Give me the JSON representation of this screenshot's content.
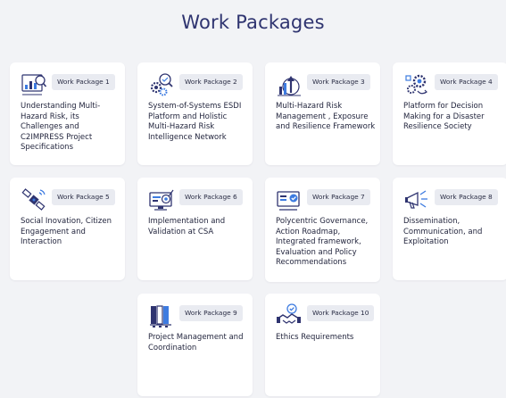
{
  "page": {
    "title": "Work Packages"
  },
  "colors": {
    "background": "#f2f3f6",
    "card": "#ffffff",
    "accent": "#2f3470",
    "badge": "#e9ebf1"
  },
  "packages": [
    {
      "label": "Work Package 1",
      "description": "Understanding Multi-Hazard Risk, its Challenges and C2IMPRESS Project Specifications",
      "icon": "bar-chart-magnifier-icon"
    },
    {
      "label": "Work Package 2",
      "description": "System-of-Systems ESDI Platform and Holistic Multi-Hazard Risk Intelligence Network",
      "icon": "gears-magnifier-icon"
    },
    {
      "label": "Work Package 3",
      "description": "Multi-Hazard Risk Management , Exposure and Resilience Framework",
      "icon": "risk-growth-icon"
    },
    {
      "label": "Work Package 4",
      "description": "Platform for Decision Making for a Disaster Resilience Society",
      "icon": "decision-gears-icon"
    },
    {
      "label": "Work Package 5",
      "description": "Social Inovation, Citizen Engagement and Interaction",
      "icon": "satellite-icon"
    },
    {
      "label": "Work Package 6",
      "description": "Implementation and Validation at CSA",
      "icon": "monitor-target-icon"
    },
    {
      "label": "Work Package 7",
      "description": "Polycentric Governance, Action Roadmap, Integrated framework, Evaluation and Policy Recommendations",
      "icon": "checklist-icon"
    },
    {
      "label": "Work Package 8",
      "description": "Dissemination, Communication, and Exploitation",
      "icon": "megaphone-icon"
    },
    {
      "label": "Work Package 9",
      "description": "Project Management and Coordination",
      "icon": "folders-icon"
    },
    {
      "label": "Work Package 10",
      "description": "Ethics Requirements",
      "icon": "handshake-check-icon"
    }
  ]
}
